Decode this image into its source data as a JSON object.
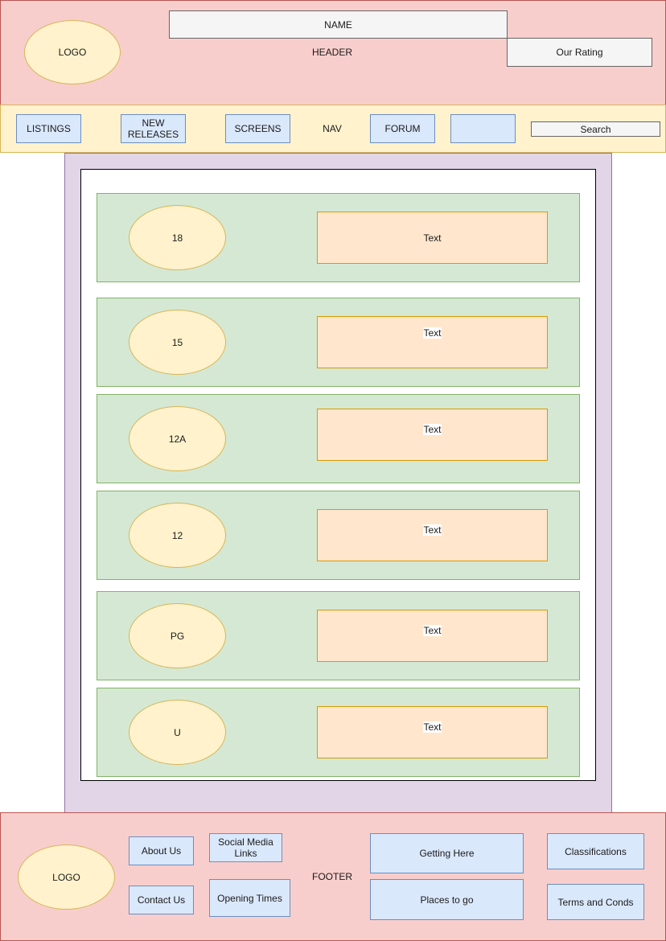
{
  "header": {
    "label": "HEADER",
    "logo": "LOGO",
    "name": "NAME",
    "rating": "Our Rating"
  },
  "nav": {
    "label": "NAV",
    "listings": "LISTINGS",
    "new_releases_line1": "NEW",
    "new_releases_line2": "RELEASES",
    "screens": "SCREENS",
    "forum": "FORUM",
    "blank": "",
    "search": "Search"
  },
  "ratings": [
    {
      "badge": "18",
      "text": "Text"
    },
    {
      "badge": "15",
      "text": "Text"
    },
    {
      "badge": "12A",
      "text": "Text"
    },
    {
      "badge": "12",
      "text": "Text"
    },
    {
      "badge": "PG",
      "text": "Text"
    },
    {
      "badge": "U",
      "text": "Text"
    }
  ],
  "footer": {
    "label": "FOOTER",
    "logo": "LOGO",
    "about": "About Us",
    "contact": "Contact Us",
    "social_line1": "Social Media",
    "social_line2": "Links",
    "opening": "Opening Times",
    "getting_here": "Getting Here",
    "places": "Places to go",
    "classifications": "Classifications",
    "terms": "Terms and Conds"
  },
  "colors": {
    "header_fill": "#f8cecc",
    "nav_fill": "#fff2cc",
    "button_fill": "#dae8fc",
    "content_fill": "#e1d5e7",
    "row_fill": "#d5e8d4",
    "text_box_fill": "#ffe6cc"
  }
}
